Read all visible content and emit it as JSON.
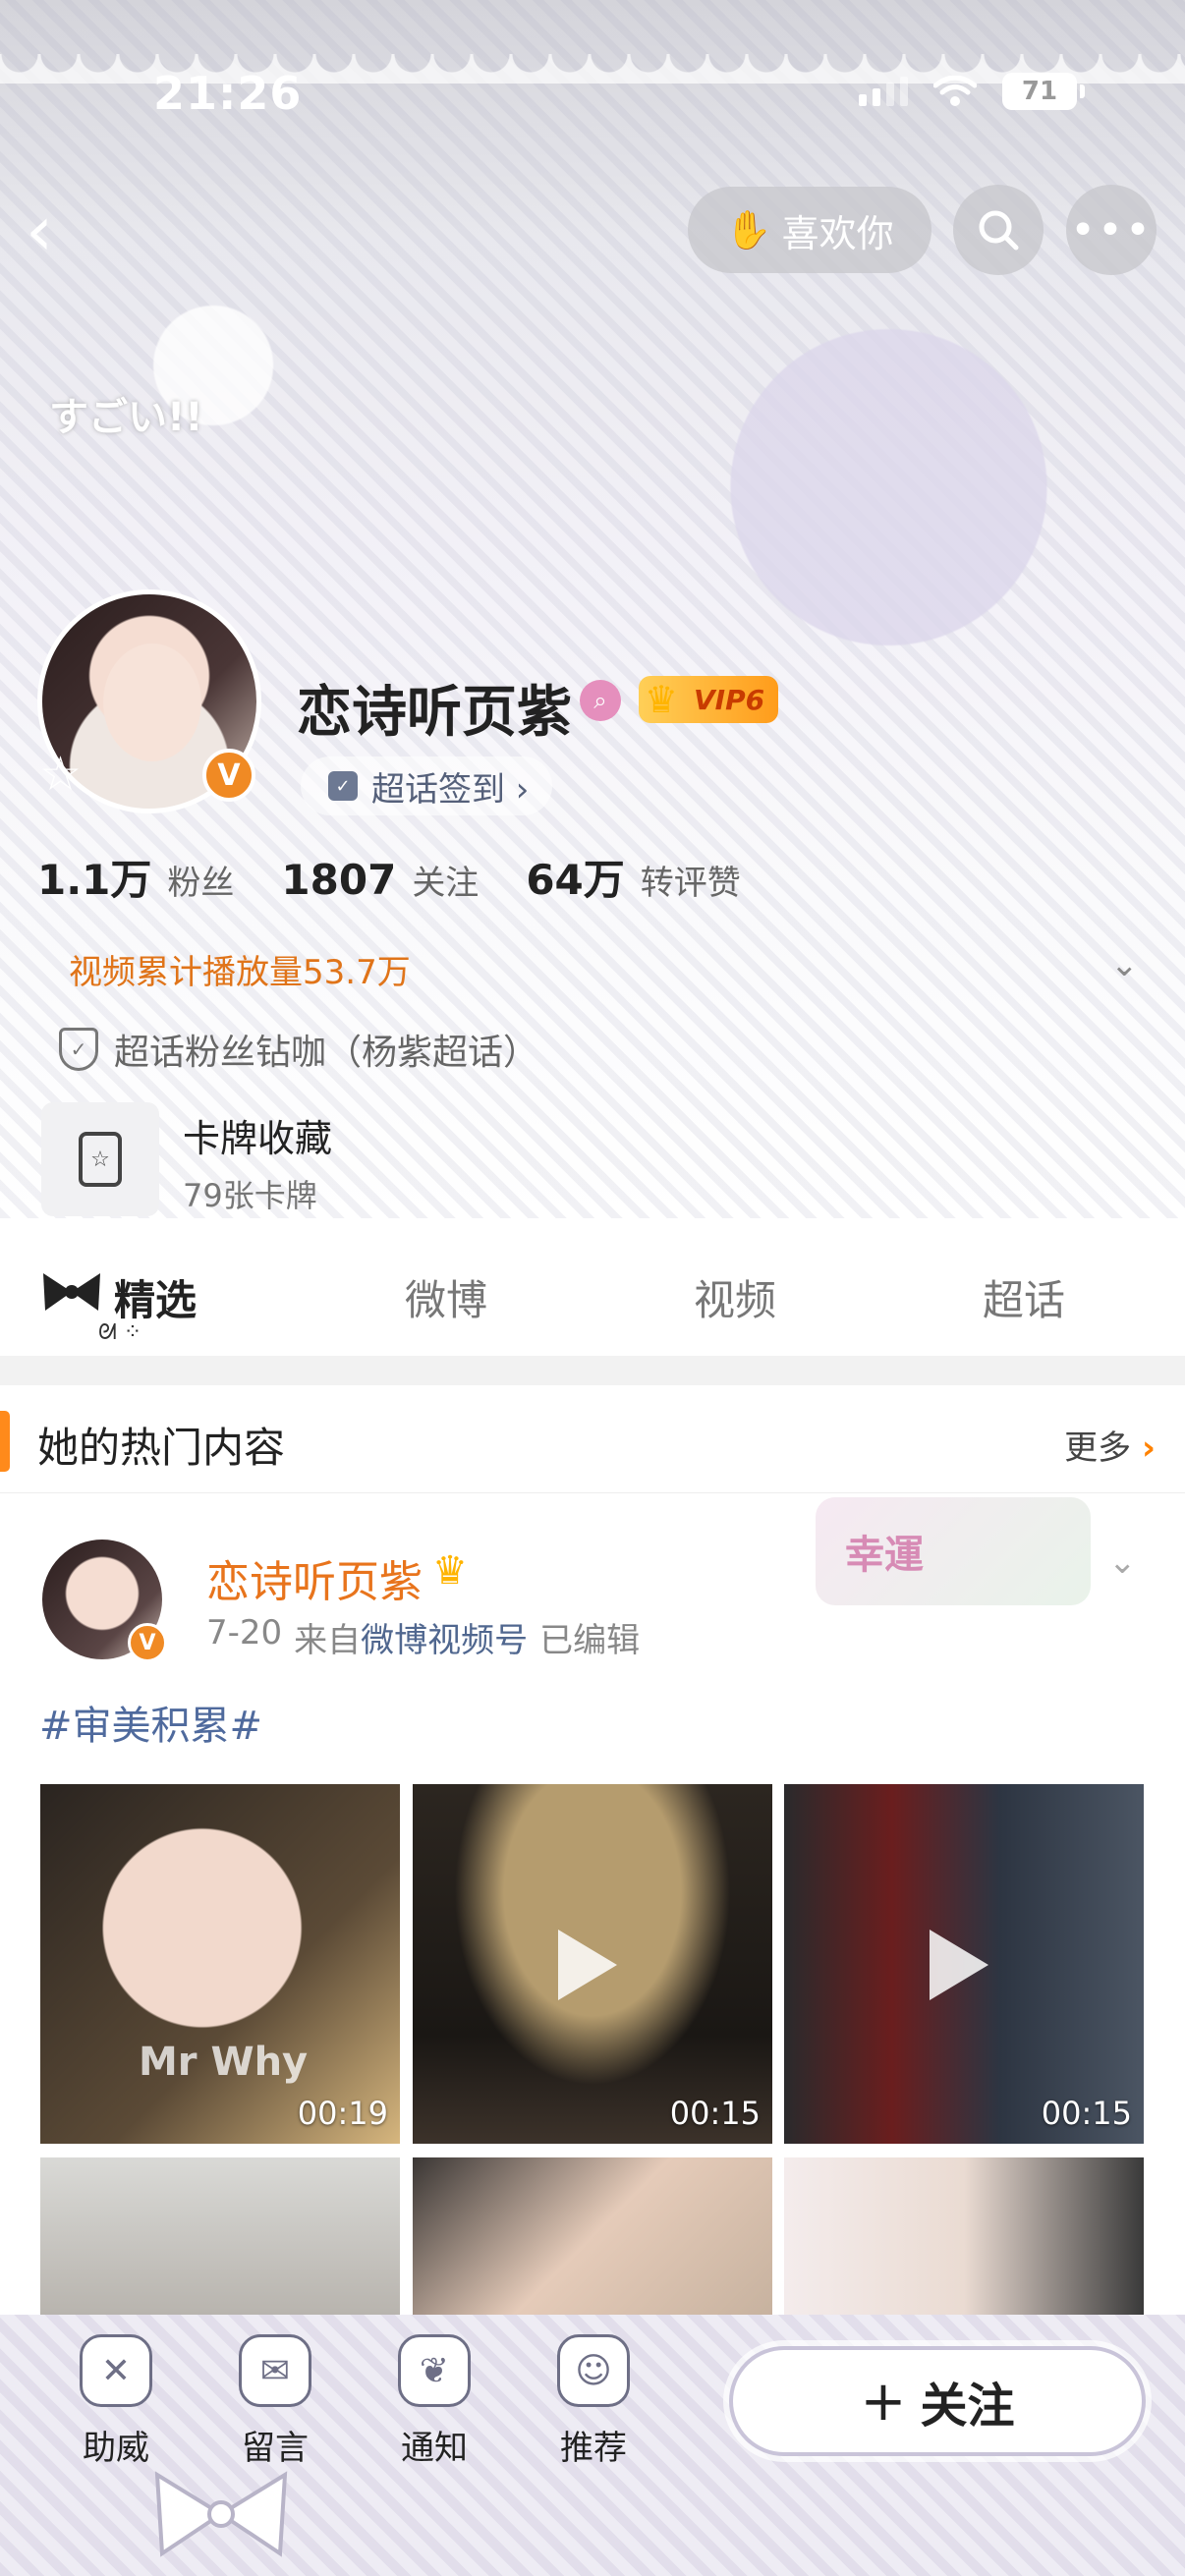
{
  "status_bar": {
    "time": "21:26",
    "battery": "71"
  },
  "nav": {
    "back": "‹",
    "like_label": "喜欢你",
    "like_icon": "✋"
  },
  "header_deco": {
    "text": "すごい!!"
  },
  "profile": {
    "name": "恋诗听页紫",
    "vip_label": "VIP6",
    "verified": "V",
    "checkin_label": "超话签到 ›",
    "stats": [
      {
        "num": "1.1万",
        "label": "粉丝"
      },
      {
        "num": "1807",
        "label": "关注"
      },
      {
        "num": "64万",
        "label": "转评赞"
      }
    ],
    "video_plays": "视频累计播放量53.7万",
    "fan_title": "超话粉丝钻咖（杨紫超话）",
    "card": {
      "title": "卡牌收藏",
      "count": "79张卡牌"
    }
  },
  "tabs": [
    {
      "label": "精选",
      "active": true
    },
    {
      "label": "微博",
      "active": false
    },
    {
      "label": "视频",
      "active": false
    },
    {
      "label": "超话",
      "active": false
    }
  ],
  "hot": {
    "title": "她的热门内容",
    "more": "更多",
    "post": {
      "author": "恋诗听页紫",
      "date": "7-20",
      "from_prefix": "来自",
      "source": "微博视频号",
      "edited": "已编辑",
      "hashtag": "#审美积累#",
      "sticker_text": "幸運"
    },
    "media": [
      {
        "duration": "00:19",
        "watermark": "Mr Why"
      },
      {
        "duration": "00:15"
      },
      {
        "duration": "00:15"
      }
    ]
  },
  "bottom_bar": {
    "items": [
      {
        "label": "助威",
        "icon": "cheer-icon"
      },
      {
        "label": "留言",
        "icon": "message-icon"
      },
      {
        "label": "通知",
        "icon": "bell-icon"
      },
      {
        "label": "推荐",
        "icon": "recommend-icon"
      }
    ],
    "follow_label": "关注",
    "follow_plus": "+"
  },
  "colors": {
    "accent": "#ff8200",
    "name_orange": "#e8741c",
    "link_blue": "#4f6a9d"
  }
}
